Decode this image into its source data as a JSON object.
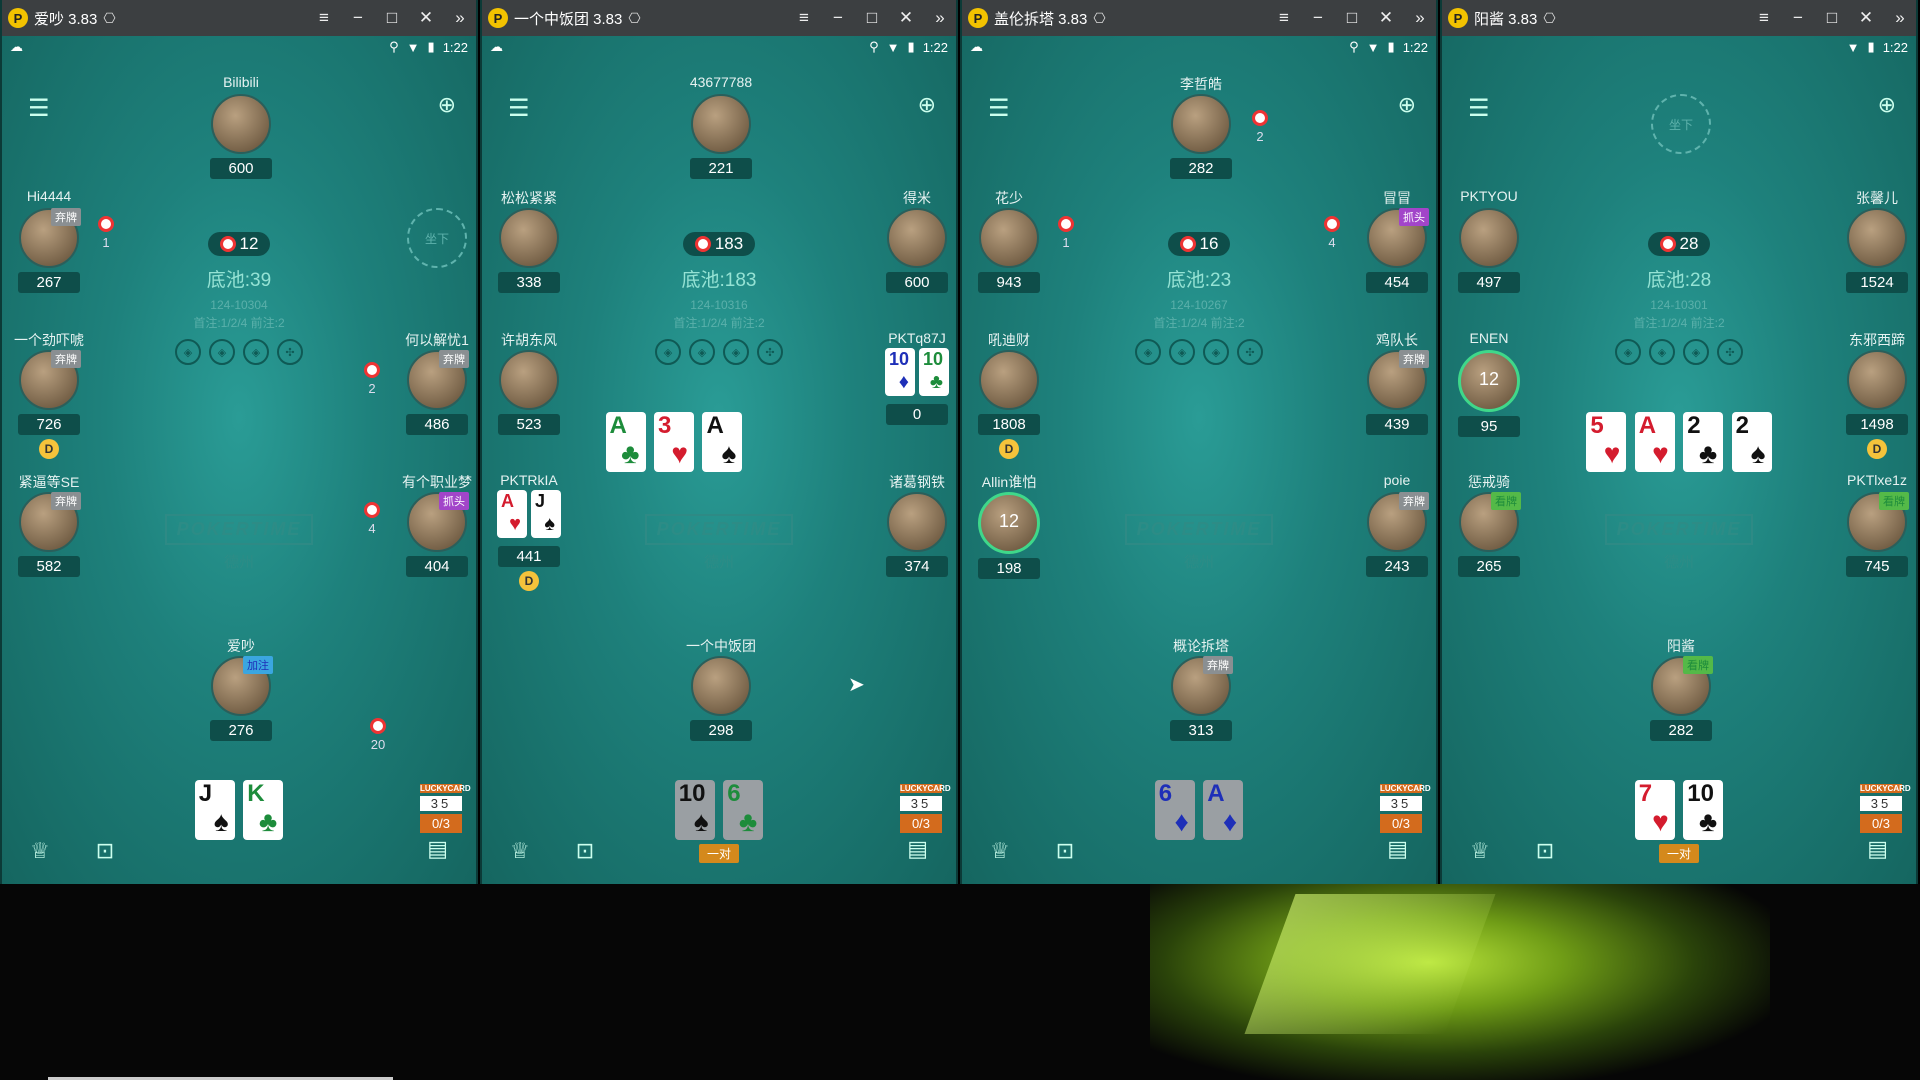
{
  "windows": [
    {
      "title": "爱吵 3.83",
      "status_time": "1:22",
      "pot": {
        "chips": "12",
        "label": "底池:39",
        "hand_id": "124-10304",
        "rule": "首注:1/2/4 前注:2"
      },
      "players": {
        "top": {
          "name": "Bilibili",
          "chips": "600"
        },
        "lu": {
          "name": "Hi4444",
          "chips": "267",
          "tag": "弃牌",
          "bet": "1"
        },
        "lm": {
          "name": "一个劲吓唬",
          "chips": "726",
          "tag": "弃牌"
        },
        "ll": {
          "name": "紧逼等SE",
          "chips": "582",
          "tag": "弃牌"
        },
        "ru": {
          "name": "",
          "seat_label": "坐下"
        },
        "rm": {
          "name": "何以解忧1",
          "chips": "486",
          "tag": "弃牌",
          "bet": "2"
        },
        "rl": {
          "name": "有个职业梦",
          "chips": "404",
          "tag": "抓头",
          "bet": "4"
        },
        "hero": {
          "name": "爱吵",
          "chips": "276",
          "tag": "加注",
          "bet": "20"
        }
      },
      "dealer_label": "D",
      "board": [],
      "hero_cards": [
        {
          "rank": "J",
          "suit": "♠",
          "color": "black"
        },
        {
          "rank": "K",
          "suit": "♣",
          "color": "green"
        }
      ],
      "hand_tag": "",
      "lucky": {
        "title": "LUCKYCARD",
        "nums": "35",
        "progress": "0/3"
      }
    },
    {
      "title": "一个中饭团 3.83",
      "status_time": "1:22",
      "pot": {
        "chips": "183",
        "label": "底池:183",
        "hand_id": "124-10316",
        "rule": "首注:1/2/4 前注:2"
      },
      "players": {
        "top": {
          "name": "43677788",
          "chips": "221"
        },
        "lu": {
          "name": "松松紧紧",
          "chips": "338"
        },
        "lm": {
          "name": "许胡东风",
          "chips": "523"
        },
        "ll": {
          "name": "PKTRkIA",
          "chips": "441"
        },
        "ru": {
          "name": "得米",
          "chips": "600"
        },
        "rm": {
          "name": "PKTq87J",
          "chips": "0"
        },
        "rl": {
          "name": "诸葛钢铁",
          "chips": "374"
        },
        "hero": {
          "name": "一个中饭团",
          "chips": "298"
        }
      },
      "dealer_label": "D",
      "board": [
        {
          "rank": "A",
          "suit": "♣",
          "color": "green"
        },
        {
          "rank": "3",
          "suit": "♥",
          "color": "red"
        },
        {
          "rank": "A",
          "suit": "♠",
          "color": "black"
        }
      ],
      "ll_cards": [
        {
          "rank": "A",
          "suit": "♥",
          "color": "red"
        },
        {
          "rank": "J",
          "suit": "♠",
          "color": "black"
        }
      ],
      "rm_cards": [
        {
          "rank": "10",
          "suit": "♦",
          "color": "blue"
        },
        {
          "rank": "10",
          "suit": "♣",
          "color": "green"
        }
      ],
      "hero_cards": [
        {
          "rank": "10",
          "suit": "♠",
          "color": "black"
        },
        {
          "rank": "6",
          "suit": "♣",
          "color": "green"
        }
      ],
      "hand_tag": "一对",
      "lucky": {
        "title": "LUCKYCARD",
        "nums": "35",
        "progress": "0/3"
      }
    },
    {
      "title": "盖伦拆塔 3.83",
      "status_time": "1:22",
      "pot": {
        "chips": "16",
        "label": "底池:23",
        "hand_id": "124-10267",
        "rule": "首注:1/2/4 前注:2"
      },
      "players": {
        "top": {
          "name": "李哲皓",
          "chips": "282",
          "bet": "2"
        },
        "lu": {
          "name": "花少",
          "chips": "943",
          "bet": "1"
        },
        "lm": {
          "name": "吼迪财",
          "chips": "1808"
        },
        "ll": {
          "name": "Allin谁怕",
          "chips": "198",
          "timer": "12"
        },
        "ru": {
          "name": "冒冒",
          "chips": "454",
          "tag": "抓头",
          "bet": "4"
        },
        "rm": {
          "name": "鸡队长",
          "chips": "439",
          "tag": "弃牌"
        },
        "rl": {
          "name": "poie",
          "chips": "243",
          "tag": "弃牌"
        },
        "hero": {
          "name": "概论拆塔",
          "chips": "313",
          "tag": "弃牌"
        }
      },
      "dealer_label": "D",
      "board": [],
      "hero_cards": [
        {
          "rank": "6",
          "suit": "♦",
          "color": "blue"
        },
        {
          "rank": "A",
          "suit": "♦",
          "color": "blue"
        }
      ],
      "hand_tag": "",
      "lucky": {
        "title": "LUCKYCARD",
        "nums": "35",
        "progress": "0/3"
      }
    },
    {
      "title": "阳酱 3.83",
      "status_time": "1:22",
      "pot": {
        "chips": "28",
        "label": "底池:28",
        "hand_id": "124-10301",
        "rule": "首注:1/2/4 前注:2"
      },
      "players": {
        "top": {
          "name": "",
          "seat_label": "坐下"
        },
        "lu": {
          "name": "PKTYOU",
          "chips": "497"
        },
        "lm": {
          "name": "ENEN",
          "chips": "95",
          "timer": "12"
        },
        "ll": {
          "name": "惩戒骑",
          "chips": "265",
          "tag": "看牌"
        },
        "ru": {
          "name": "张馨儿",
          "chips": "1524"
        },
        "rm": {
          "name": "东邪西蹄",
          "chips": "1498"
        },
        "rl": {
          "name": "PKTlxe1z",
          "chips": "745",
          "tag": "看牌"
        },
        "hero": {
          "name": "阳酱",
          "chips": "282",
          "tag": "看牌"
        }
      },
      "dealer_label": "D",
      "board": [
        {
          "rank": "5",
          "suit": "♥",
          "color": "red"
        },
        {
          "rank": "A",
          "suit": "♥",
          "color": "red"
        },
        {
          "rank": "2",
          "suit": "♣",
          "color": "black"
        },
        {
          "rank": "2",
          "suit": "♠",
          "color": "black"
        }
      ],
      "hero_cards": [
        {
          "rank": "7",
          "suit": "♥",
          "color": "red"
        },
        {
          "rank": "10",
          "suit": "♣",
          "color": "black"
        }
      ],
      "hand_tag": "一对",
      "lucky": {
        "title": "LUCKYCARD",
        "nums": "35",
        "progress": "0/3"
      }
    }
  ],
  "brand": {
    "main": "POKERTIME",
    "sub": "德州"
  },
  "icons": {
    "menu": "menu-icon",
    "rebuy": "chip-plus-icon",
    "trophy": "trophy-icon",
    "ai": "ai-icon",
    "chat": "chat-icon"
  }
}
